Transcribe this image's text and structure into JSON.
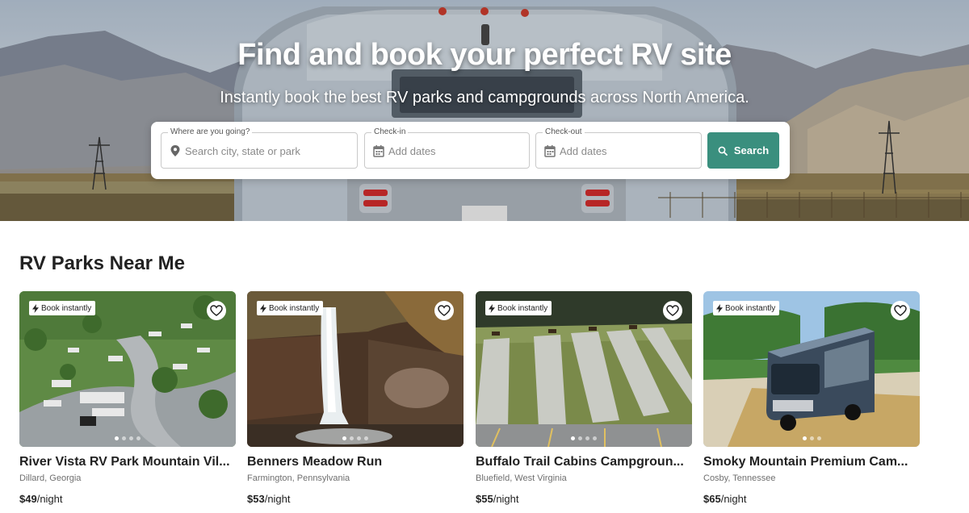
{
  "hero": {
    "title": "Find and book your perfect RV site",
    "subtitle": "Instantly book the best RV parks and campgrounds across North America."
  },
  "search": {
    "location_label": "Where are you going?",
    "location_placeholder": "Search city, state or park",
    "checkin_label": "Check-in",
    "checkin_placeholder": "Add dates",
    "checkout_label": "Check-out",
    "checkout_placeholder": "Add dates",
    "button_label": "Search",
    "button_color": "#3a8f7e"
  },
  "section": {
    "title": "RV Parks Near Me"
  },
  "cards": [
    {
      "badge": "Book instantly",
      "name": "River Vista RV Park Mountain Vil...",
      "location": "Dillard, Georgia",
      "price": "$49",
      "unit": "/night"
    },
    {
      "badge": "Book instantly",
      "name": "Benners Meadow Run",
      "location": "Farmington, Pennsylvania",
      "price": "$53",
      "unit": "/night"
    },
    {
      "badge": "Book instantly",
      "name": "Buffalo Trail Cabins Campgroun...",
      "location": "Bluefield, West Virginia",
      "price": "$55",
      "unit": "/night"
    },
    {
      "badge": "Book instantly",
      "name": "Smoky Mountain Premium Cam...",
      "location": "Cosby, Tennessee",
      "price": "$65",
      "unit": "/night"
    }
  ]
}
